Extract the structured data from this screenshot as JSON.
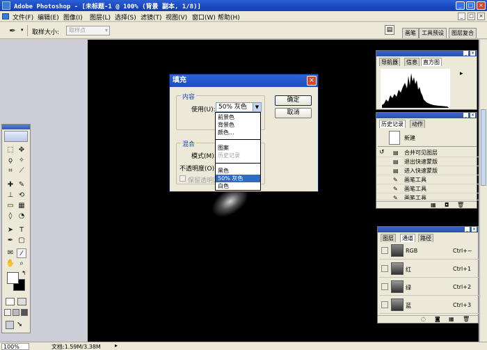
{
  "app": {
    "title": "Adobe Photoshop - [未标题-1 @ 100% (背景 副本, 1/8)]"
  },
  "window_controls": {
    "minimize": "_",
    "maximize": "□",
    "close": "×"
  },
  "menu": {
    "items": [
      "文件(F)",
      "编辑(E)",
      "图像(I)",
      "图层(L)",
      "选择(S)",
      "滤镜(T)",
      "视图(V)",
      "窗口(W)",
      "帮助(H)"
    ]
  },
  "options_bar": {
    "tool_icon": "eyedropper-icon",
    "sample_size_label": "取样大小:",
    "sample_size_value": "取样点",
    "palette_well_tabs": [
      "画笔",
      "工具预设",
      "图层复合"
    ]
  },
  "fill_dialog": {
    "title": "填充",
    "content_group": "内容",
    "use_label": "使用(U):",
    "use_value": "50% 灰色",
    "blending_group": "混合",
    "mode_label": "模式(M):",
    "opacity_label": "不透明度(O):",
    "preserve_label": "保留透明区",
    "ok_label": "确定",
    "cancel_label": "取消",
    "dropdown_options": [
      {
        "label": "前景色",
        "state": "normal"
      },
      {
        "label": "背景色",
        "state": "normal"
      },
      {
        "label": "颜色...",
        "state": "normal"
      },
      {
        "label": "图案",
        "state": "normal"
      },
      {
        "label": "历史记录",
        "state": "disabled"
      },
      {
        "label": "黑色",
        "state": "normal"
      },
      {
        "label": "50% 灰色",
        "state": "selected"
      },
      {
        "label": "白色",
        "state": "normal"
      }
    ]
  },
  "navigator_palette": {
    "tabs": [
      "导航器",
      "信息",
      "直方图"
    ],
    "active_tab": "直方图"
  },
  "history_palette": {
    "tabs": [
      "历史记录",
      "动作"
    ],
    "active_tab": "历史记录",
    "snapshot_label": "新建",
    "items": [
      "合并可见图层",
      "退出快速蒙版",
      "进入快速蒙版",
      "画笔工具",
      "画笔工具",
      "画笔工具"
    ]
  },
  "channels_palette": {
    "tabs": [
      "图层",
      "通道",
      "路径"
    ],
    "active_tab": "通道",
    "channels": [
      {
        "name": "RGB",
        "shortcut": "Ctrl+~"
      },
      {
        "name": "红",
        "shortcut": "Ctrl+1"
      },
      {
        "name": "绿",
        "shortcut": "Ctrl+2"
      },
      {
        "name": "蓝",
        "shortcut": "Ctrl+3"
      }
    ]
  },
  "status_bar": {
    "zoom": "100%",
    "doc_info": "文档:1.59M/3.38M"
  },
  "colors": {
    "title_bar": "#1d4bc2",
    "canvas_bg": "#000000",
    "workspace_bg": "#cdcdd7",
    "selection": "#316ac5"
  }
}
